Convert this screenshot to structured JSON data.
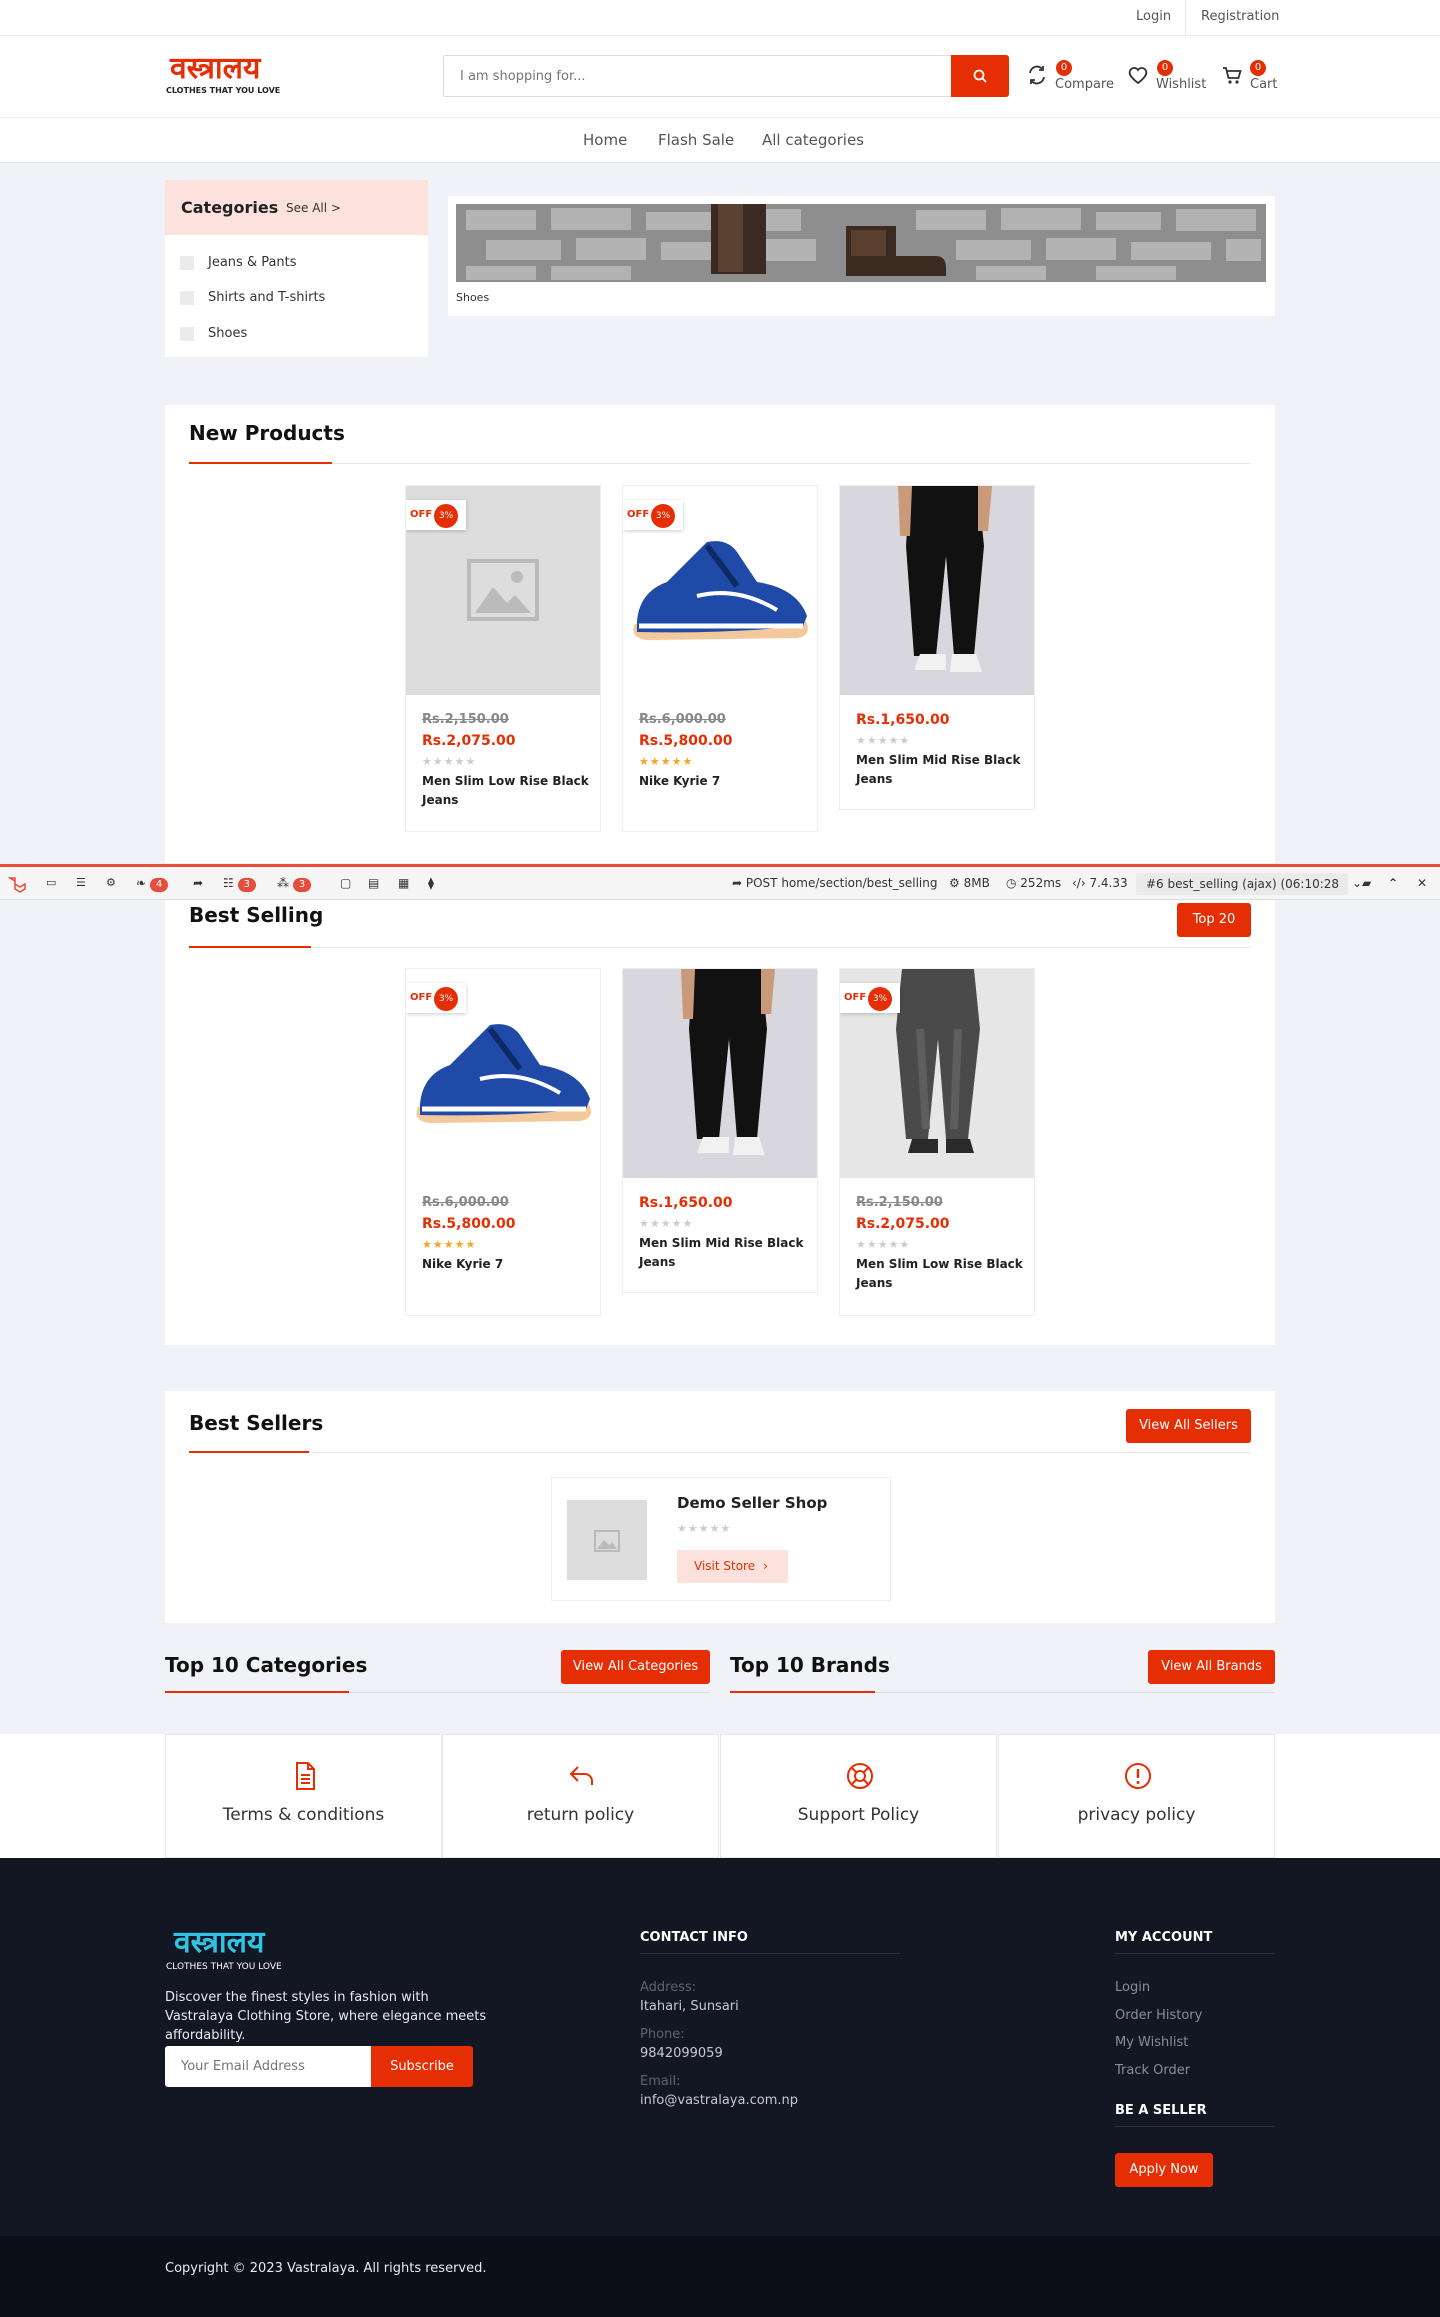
{
  "topbar": {
    "login": "Login",
    "registration": "Registration"
  },
  "logo": {
    "name": "वस्त्रालय",
    "tagline": "CLOTHES THAT YOU LOVE"
  },
  "search": {
    "placeholder": "I am shopping for..."
  },
  "header_actions": {
    "compare": {
      "label": "Compare",
      "count": "0"
    },
    "wishlist": {
      "label": "Wishlist",
      "count": "0"
    },
    "cart": {
      "label": "Cart",
      "count": "0"
    }
  },
  "nav": [
    "Home",
    "Flash Sale",
    "All categories"
  ],
  "categories": {
    "title": "Categories",
    "see_all": "See All >",
    "items": [
      "Jeans & Pants",
      "Shirts and T-shirts",
      "Shoes"
    ]
  },
  "banner": {
    "caption": "Shoes"
  },
  "new_products": {
    "title": "New Products",
    "items": [
      {
        "old_price": "Rs.2,150.00",
        "price": "Rs.2,075.00",
        "stars": "★★★★★",
        "rated": false,
        "name": "Men Slim Low Rise Black Jeans",
        "off_label": "OFF",
        "off": "3%",
        "img": "placeholder"
      },
      {
        "old_price": "Rs.6,000.00",
        "price": "Rs.5,800.00",
        "stars": "★★★★★",
        "rated": true,
        "name": "Nike Kyrie 7",
        "off_label": "OFF",
        "off": "3%",
        "img": "shoe"
      },
      {
        "old_price": "",
        "price": "Rs.1,650.00",
        "stars": "★★★★★",
        "rated": false,
        "name": "Men Slim Mid Rise Black Jeans",
        "off_label": "",
        "off": "",
        "img": "black-jeans"
      }
    ]
  },
  "debugbar": {
    "badges": [
      "4",
      "3",
      "3"
    ],
    "request": "POST home/section/best_selling",
    "memory": "8MB",
    "time": "252ms",
    "php": "7.4.33",
    "select": "#6 best_selling (ajax) (06:10:28"
  },
  "best_selling": {
    "title": "Best Selling",
    "button": "Top 20",
    "items": [
      {
        "old_price": "Rs.6,000.00",
        "price": "Rs.5,800.00",
        "stars": "★★★★★",
        "rated": true,
        "name": "Nike Kyrie 7",
        "off_label": "OFF",
        "off": "3%",
        "img": "shoe"
      },
      {
        "old_price": "",
        "price": "Rs.1,650.00",
        "stars": "★★★★★",
        "rated": false,
        "name": "Men Slim Mid Rise Black Jeans",
        "off_label": "",
        "off": "",
        "img": "black-jeans"
      },
      {
        "old_price": "Rs.2,150.00",
        "price": "Rs.2,075.00",
        "stars": "★★★★★",
        "rated": false,
        "name": "Men Slim Low Rise Black Jeans",
        "off_label": "OFF",
        "off": "3%",
        "img": "grey-jeans"
      }
    ]
  },
  "best_sellers": {
    "title": "Best Sellers",
    "button": "View All Sellers",
    "seller": {
      "name": "Demo Seller Shop",
      "stars": "★★★★★",
      "visit": "Visit Store"
    }
  },
  "top_categories": {
    "title": "Top 10 Categories",
    "button": "View All Categories"
  },
  "top_brands": {
    "title": "Top 10 Brands",
    "button": "View All Brands"
  },
  "policies": [
    "Terms & conditions",
    "return policy",
    "Support Policy",
    "privacy policy"
  ],
  "footer": {
    "about": "Discover the finest styles in fashion with Vastralaya Clothing Store, where elegance meets affordability.",
    "email_placeholder": "Your Email Address",
    "subscribe": "Subscribe",
    "contact_title": "CONTACT INFO",
    "address_label": "Address:",
    "address": "Itahari, Sunsari",
    "phone_label": "Phone:",
    "phone": "9842099059",
    "email_label": "Email:",
    "email": "info@vastralaya.com.np",
    "account_title": "MY ACCOUNT",
    "account_links": [
      "Login",
      "Order History",
      "My Wishlist",
      "Track Order"
    ],
    "seller_title": "BE A SELLER",
    "apply": "Apply Now",
    "copyright": "Copyright © 2023 Vastralaya. All rights reserved."
  },
  "colors": {
    "accent": "#e62e04",
    "footer_bg": "#131623",
    "logo_footer": "#2ec4e6"
  }
}
